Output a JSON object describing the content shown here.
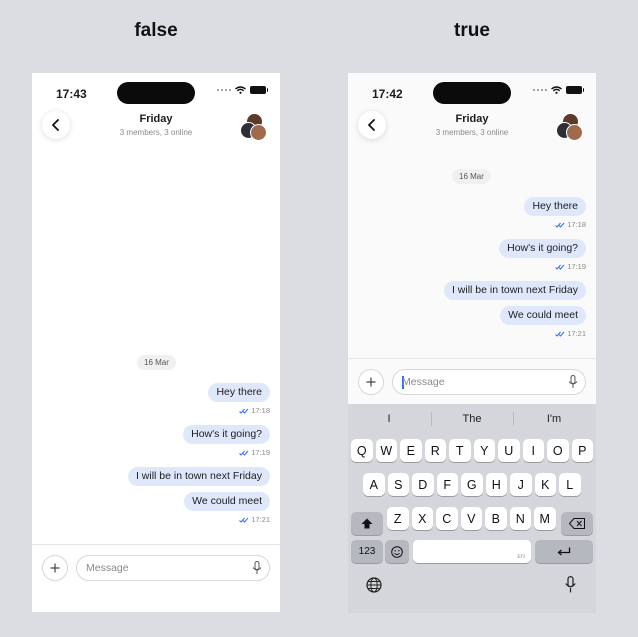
{
  "panels": [
    {
      "label": "false",
      "status_time": "17:43",
      "header": {
        "title": "Friday",
        "subtitle": "3 members, 3 online"
      },
      "date_chip": "16 Mar",
      "messages": [
        {
          "text": "Hey there",
          "time": "17:18"
        },
        {
          "text": "How's it going?",
          "time": "17:19"
        },
        {
          "text": "I will be in town next Friday",
          "time": ""
        },
        {
          "text": "We could meet",
          "time": "17:21"
        }
      ],
      "input": {
        "placeholder": "Message",
        "value": ""
      }
    },
    {
      "label": "true",
      "status_time": "17:42",
      "header": {
        "title": "Friday",
        "subtitle": "3 members, 3 online"
      },
      "date_chip": "16 Mar",
      "messages": [
        {
          "text": "Hey there",
          "time": "17:18"
        },
        {
          "text": "How's it going?",
          "time": "17:19"
        },
        {
          "text": "I will be in town next Friday",
          "time": ""
        },
        {
          "text": "We could meet",
          "time": "17:21"
        }
      ],
      "input": {
        "placeholder": "Message",
        "value": ""
      },
      "keyboard": {
        "suggestions": [
          "I",
          "The",
          "I'm"
        ],
        "row1": [
          "Q",
          "W",
          "E",
          "R",
          "T",
          "Y",
          "U",
          "I",
          "O",
          "P"
        ],
        "row2": [
          "A",
          "S",
          "D",
          "F",
          "G",
          "H",
          "J",
          "K",
          "L"
        ],
        "row3": [
          "Z",
          "X",
          "C",
          "V",
          "B",
          "N",
          "M"
        ],
        "numbers_key": "123",
        "space_hint": "EN"
      }
    }
  ],
  "colors": {
    "bubble": "#dfe8fb",
    "read_check": "#2f6bff",
    "background": "#dcdde3"
  },
  "icons": {
    "back": "chevron-left-icon",
    "plus": "plus-icon",
    "mic": "microphone-icon",
    "shift": "shift-icon",
    "backspace": "backspace-icon",
    "emoji": "emoji-icon",
    "return": "return-icon",
    "globe": "globe-icon",
    "wifi": "wifi-icon",
    "battery": "battery-icon",
    "read_receipt": "double-check-icon"
  }
}
